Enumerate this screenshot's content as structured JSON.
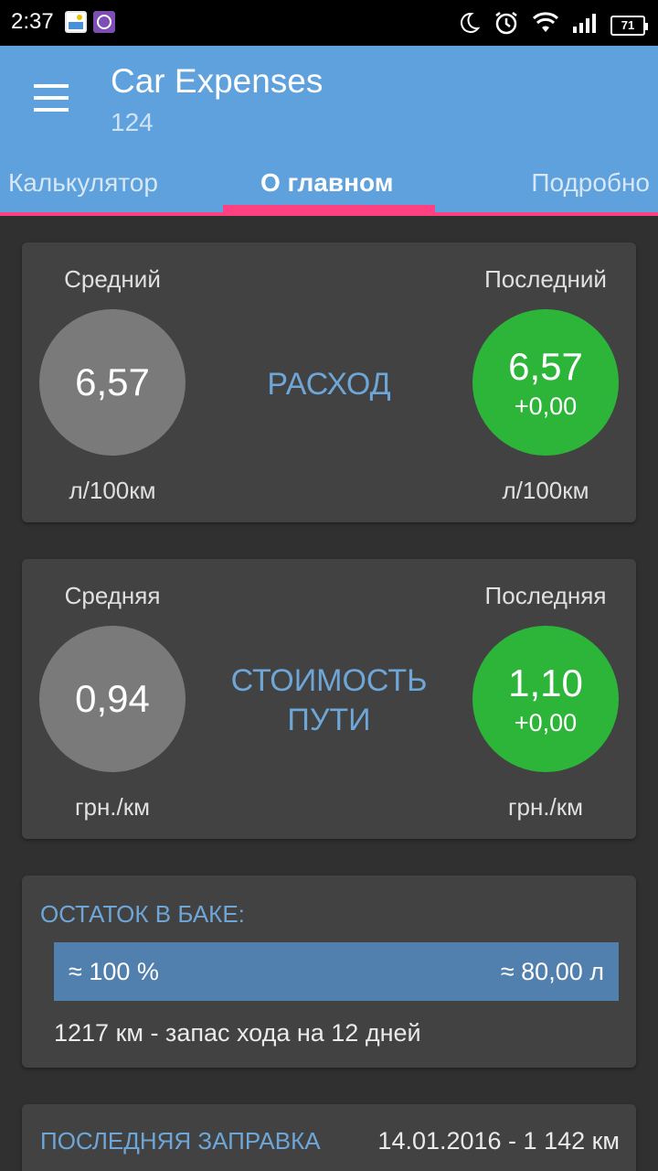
{
  "status_bar": {
    "time": "2:37",
    "battery": "71",
    "icons": [
      "notification-image-icon",
      "viber-icon",
      "moon-icon",
      "alarm-icon",
      "wifi-icon",
      "signal-icon",
      "battery-icon"
    ]
  },
  "app_bar": {
    "title": "Car Expenses",
    "subtitle": "124"
  },
  "tabs": [
    {
      "label": "Калькулятор"
    },
    {
      "label": "О главном"
    },
    {
      "label": "Подробно"
    }
  ],
  "consumption": {
    "avg_label": "Средний",
    "last_label": "Последний",
    "avg_value": "6,57",
    "last_value": "6,57",
    "last_delta": "+0,00",
    "title": "РАСХОД",
    "unit_left": "л/100км",
    "unit_right": "л/100км"
  },
  "cost": {
    "avg_label": "Средняя",
    "last_label": "Последняя",
    "avg_value": "0,94",
    "last_value": "1,10",
    "last_delta": "+0,00",
    "title_line1": "СТОИМОСТЬ",
    "title_line2": "ПУТИ",
    "unit_left": "грн./км",
    "unit_right": "грн./км"
  },
  "tank": {
    "title": "ОСТАТОК В БАКЕ:",
    "percent": "≈ 100 %",
    "liters": "≈ 80,00 л",
    "range": "1217 км - запас хода на 12 дней"
  },
  "last_refuel": {
    "title": "ПОСЛЕДНЯЯ ЗАПРАВКА",
    "value": "14.01.2016 - 1 142 км"
  },
  "colors": {
    "app_bar": "#5ea1dc",
    "tab_indicator": "#ff4081",
    "accent_text": "#6fa6d8",
    "green": "#2db53a",
    "gray_circle": "#7a7a7a",
    "card": "#424242",
    "background": "#303030"
  }
}
